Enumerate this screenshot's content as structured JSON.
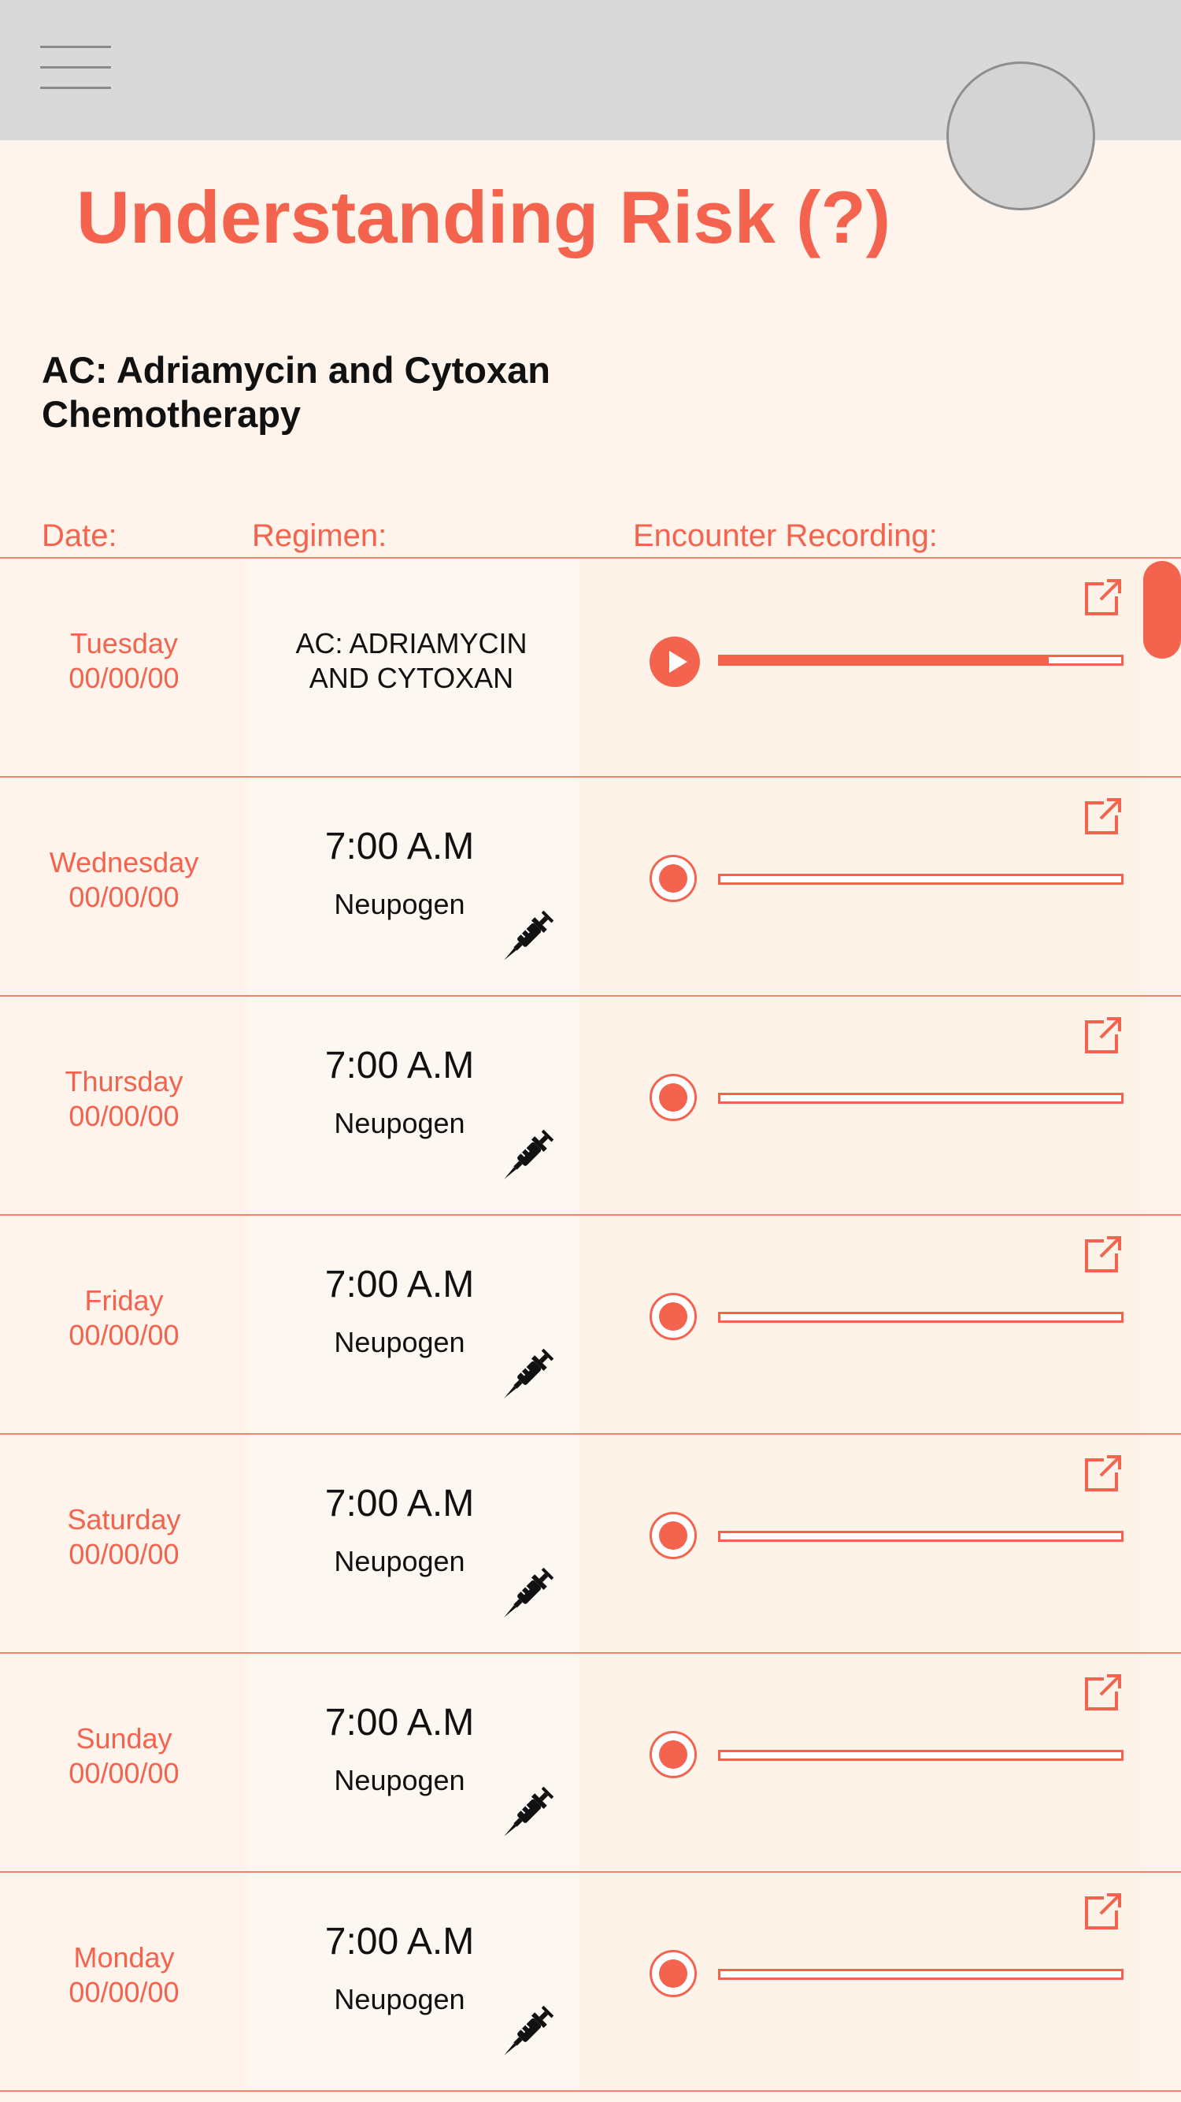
{
  "header": {
    "menu_icon": "hamburger-menu-icon",
    "avatar_icon": "avatar"
  },
  "page": {
    "title": "Understanding Risk (?)",
    "subtitle": "AC: Adriamycin and Cytoxan Chemotherapy"
  },
  "columns": {
    "date": "Date:",
    "regimen": "Regimen:",
    "recording": "Encounter Recording:"
  },
  "colors": {
    "accent": "#f4634e",
    "background": "#fef4ec",
    "topbar": "#d9d9d9"
  },
  "rows": [
    {
      "day": "Tuesday",
      "date": "00/00/00",
      "regimen": "AC: ADRIAMYCIN AND CYTOXAN",
      "recording_state": "play",
      "progress": 0.82
    },
    {
      "day": "Wednesday",
      "date": "00/00/00",
      "time": "7:00 A.M",
      "medication": "Neupogen",
      "recording_state": "record",
      "progress": 0
    },
    {
      "day": "Thursday",
      "date": "00/00/00",
      "time": "7:00 A.M",
      "medication": "Neupogen",
      "recording_state": "record",
      "progress": 0
    },
    {
      "day": "Friday",
      "date": "00/00/00",
      "time": "7:00 A.M",
      "medication": "Neupogen",
      "recording_state": "record",
      "progress": 0
    },
    {
      "day": "Saturday",
      "date": "00/00/00",
      "time": "7:00 A.M",
      "medication": "Neupogen",
      "recording_state": "record",
      "progress": 0
    },
    {
      "day": "Sunday",
      "date": "00/00/00",
      "time": "7:00 A.M",
      "medication": "Neupogen",
      "recording_state": "record",
      "progress": 0
    },
    {
      "day": "Monday",
      "date": "00/00/00",
      "time": "7:00 A.M",
      "medication": "Neupogen",
      "recording_state": "record",
      "progress": 0
    }
  ]
}
